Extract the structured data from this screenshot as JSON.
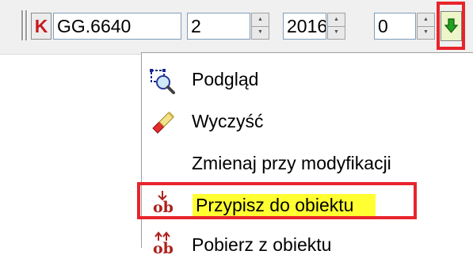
{
  "toolbar": {
    "k_label": "K",
    "code_value": "GG.6640",
    "number_value": "2",
    "year_value": "2016",
    "value_field": "0",
    "spin_up_glyph": "▲",
    "spin_down_glyph": "▼"
  },
  "menu": {
    "items": [
      {
        "label": "Podgląd",
        "icon": "preview-magnifier-icon"
      },
      {
        "label": "Wyczyść",
        "icon": "eraser-icon"
      },
      {
        "label": "Zmienaj przy modyfikacji",
        "icon": ""
      },
      {
        "label": "Przypisz do obiektu",
        "icon": "assign-to-object-icon",
        "highlighted": true
      },
      {
        "label": "Pobierz z obiektu",
        "icon": "get-from-object-icon"
      }
    ]
  },
  "icons": {
    "ob_text": "ob",
    "arrow_color": "#22a022",
    "highlight_color": "#e8242b"
  }
}
